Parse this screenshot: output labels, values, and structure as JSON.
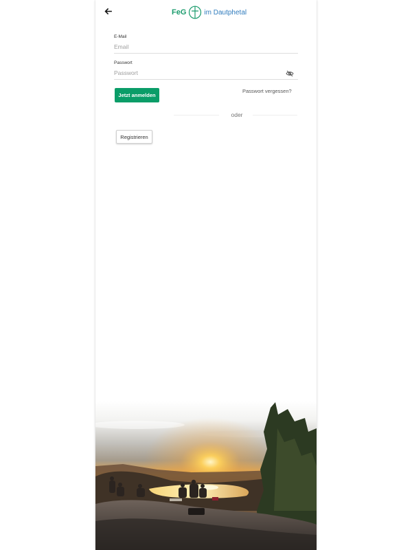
{
  "header": {
    "back_icon": "arrow-left-icon",
    "logo": {
      "brand": "FeG",
      "subtitle": "im Dautphetal",
      "icon": "cross-circle-icon",
      "color_brand": "#1a9b6c",
      "color_subtitle": "#2f7bbd"
    }
  },
  "form": {
    "email": {
      "label": "E-Mail",
      "placeholder": "Email",
      "value": ""
    },
    "password": {
      "label": "Passwort",
      "placeholder": "Passwort",
      "value": "",
      "toggle_icon": "eye-off-icon"
    },
    "login_label": "Jetzt anmelden",
    "forgot_label": "Passwort vergessen?",
    "divider_label": "oder",
    "register_label": "Registrieren"
  },
  "colors": {
    "primary": "#0a9d68",
    "background": "#ffffff"
  },
  "hero_image": {
    "icon": "sunset-landscape-image"
  }
}
